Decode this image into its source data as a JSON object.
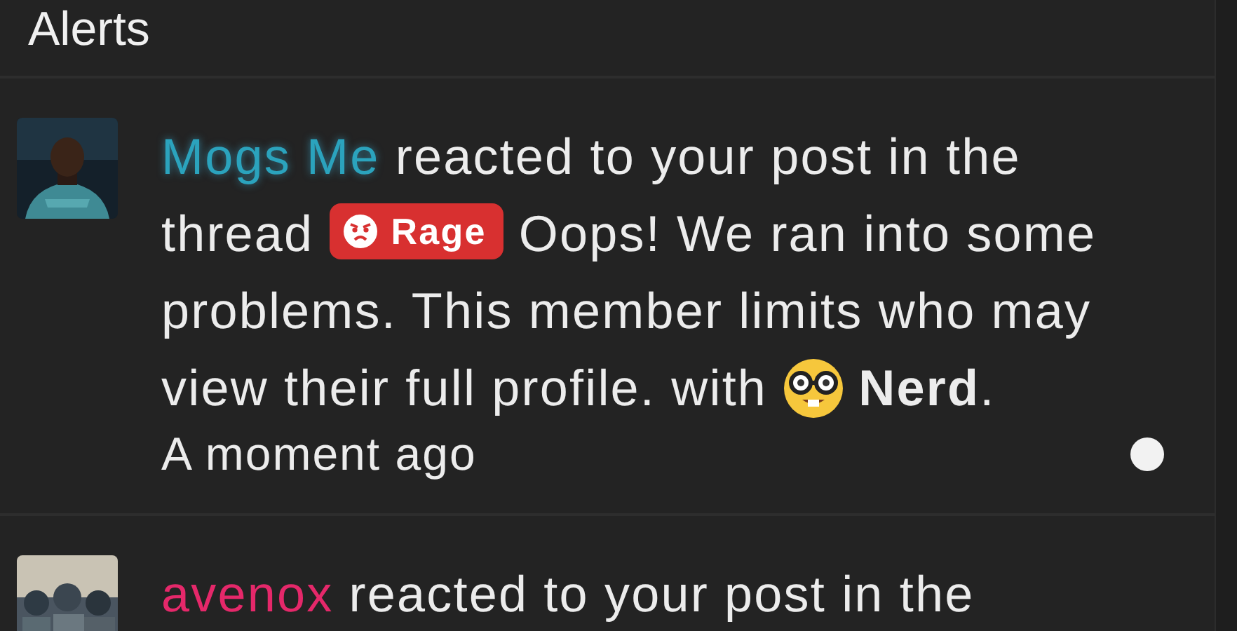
{
  "heading": "Alerts",
  "alerts": [
    {
      "user": "Mogs Me",
      "color": "#2ba3bd",
      "glow": true,
      "avatar": {
        "kind": "picture"
      },
      "parts": [
        {
          "kind": "text",
          "text": "reacted to your post in the thread"
        },
        {
          "kind": "badge",
          "text": "Rage"
        },
        {
          "kind": "text",
          "text": "Oops! We ran into some problems. This member limits who may view their full profile. with"
        },
        {
          "kind": "reaction",
          "text": "Nerd"
        },
        {
          "kind": "tail",
          "text": "."
        }
      ],
      "time": "A moment ago",
      "unread": true
    },
    {
      "user": "avenox",
      "color": "#e5286a",
      "glow": false,
      "avatar": {
        "kind": "picture"
      },
      "parts": [
        {
          "kind": "text",
          "text": "reacted to your post in the"
        }
      ]
    }
  ]
}
